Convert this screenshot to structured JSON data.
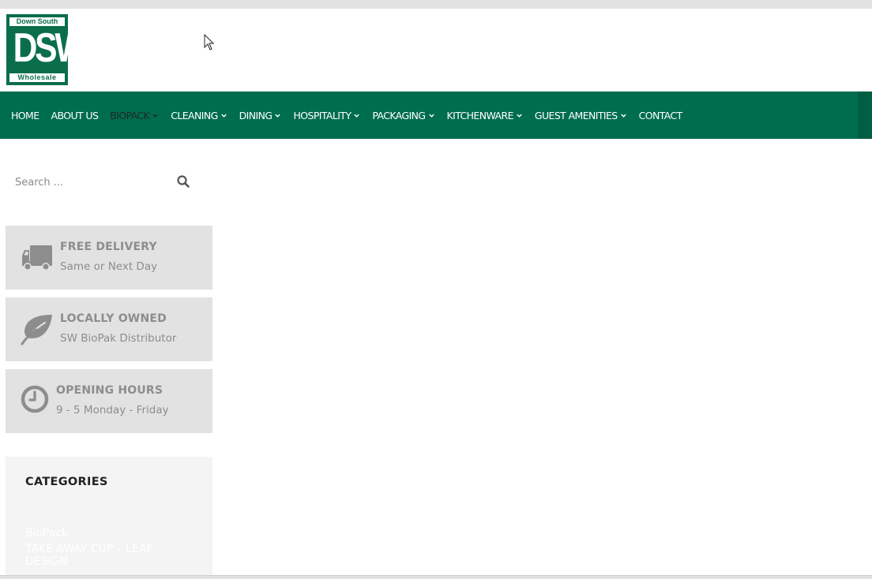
{
  "logo": {
    "top_text": "Down South",
    "main_text": "DSW",
    "bottom_text": "Wholesale"
  },
  "nav": {
    "items": [
      {
        "label": "HOME",
        "dropdown": false,
        "active": false
      },
      {
        "label": "ABOUT US",
        "dropdown": false,
        "active": false
      },
      {
        "label": "BIOPACK",
        "dropdown": true,
        "active": true
      },
      {
        "label": "CLEANING",
        "dropdown": true,
        "active": false
      },
      {
        "label": "DINING",
        "dropdown": true,
        "active": false
      },
      {
        "label": "HOSPITALITY",
        "dropdown": true,
        "active": false
      },
      {
        "label": "PACKAGING",
        "dropdown": true,
        "active": false
      },
      {
        "label": "KITCHENWARE",
        "dropdown": true,
        "active": false
      },
      {
        "label": "GUEST AMENITIES",
        "dropdown": true,
        "active": false
      },
      {
        "label": "CONTACT",
        "dropdown": false,
        "active": false
      }
    ]
  },
  "search": {
    "placeholder": "Search ...",
    "icon": "search-icon"
  },
  "features": [
    {
      "icon": "truck-icon",
      "title": "FREE DELIVERY",
      "subtitle": "Same or Next Day"
    },
    {
      "icon": "leaf-icon",
      "title": "LOCALLY OWNED",
      "subtitle": "SW BioPak Distributor"
    },
    {
      "icon": "clock-icon",
      "title": "OPENING HOURS",
      "subtitle": "9 - 5 Monday - Friday"
    }
  ],
  "categories": {
    "title": "CATEGORIES",
    "items": [
      "BioPack",
      "TAKE AWAY CUP – LEAF DESIGN"
    ]
  },
  "colors": {
    "brand_green": "#006d4f",
    "logo_green": "#0a6e4a",
    "feature_bg": "#e2e2e2",
    "feature_text": "#8d8d8d"
  }
}
